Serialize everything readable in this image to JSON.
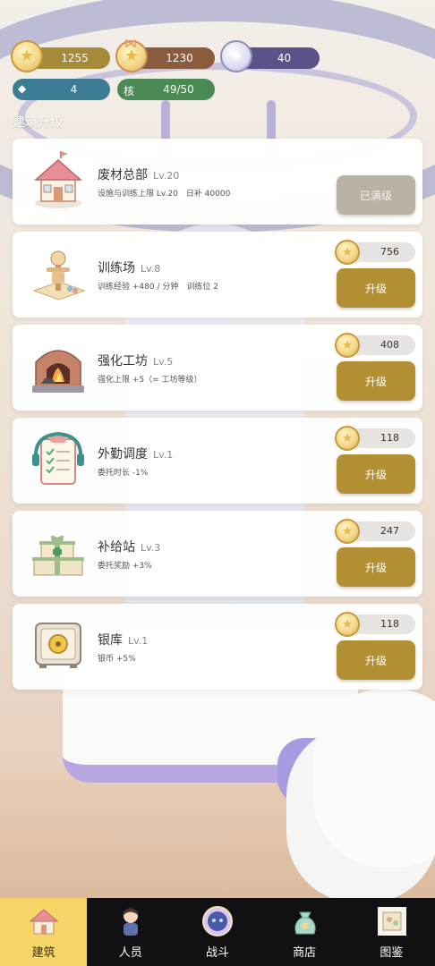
{
  "resources": {
    "coin": {
      "value": "1255",
      "icon": "coin-star-icon"
    },
    "bow_coin": {
      "value": "1230",
      "icon": "bow-coin-icon"
    },
    "gem": {
      "value": "40",
      "icon": "gem-star-icon"
    },
    "diamond": {
      "symbol": "◆",
      "value": "4"
    },
    "core": {
      "label": "核",
      "value": "49/50"
    }
  },
  "section_title": "建筑升级",
  "buildings": [
    {
      "name": "废材总部",
      "level": "Lv.20",
      "desc": "设施与训练上限 Lv.20　日补 40000",
      "button": "已满级",
      "cost": null,
      "icon": "house-icon"
    },
    {
      "name": "训练场",
      "level": "Lv.8",
      "desc": "训练经验 +480 / 分钟　训练位 2",
      "button": "升级",
      "cost": "756",
      "icon": "training-dummy-icon"
    },
    {
      "name": "强化工坊",
      "level": "Lv.5",
      "desc": "强化上限 +5（= 工坊等级）",
      "button": "升级",
      "cost": "408",
      "icon": "furnace-anvil-icon"
    },
    {
      "name": "外勤调度",
      "level": "Lv.1",
      "desc": "委托时长 -1%",
      "button": "升级",
      "cost": "118",
      "icon": "clipboard-headset-icon"
    },
    {
      "name": "补给站",
      "level": "Lv.3",
      "desc": "委托奖励 +3%",
      "button": "升级",
      "cost": "247",
      "icon": "supply-boxes-icon"
    },
    {
      "name": "银库",
      "level": "Lv.1",
      "desc": "银币 +5%",
      "button": "升级",
      "cost": "118",
      "icon": "safe-icon"
    }
  ],
  "nav": [
    {
      "label": "建筑",
      "icon": "house-icon",
      "active": true
    },
    {
      "label": "人员",
      "icon": "character-icon",
      "active": false
    },
    {
      "label": "战斗",
      "icon": "battle-orb-icon",
      "active": false
    },
    {
      "label": "商店",
      "icon": "money-bag-icon",
      "active": false
    },
    {
      "label": "图鉴",
      "icon": "book-icon",
      "active": false
    }
  ],
  "colors": {
    "upgrade_button": "#b28f33",
    "maxed_button": "#b9b3a6",
    "nav_active": "#f6d566",
    "nav_bg": "#111114",
    "coin_bar": "#a58a3a",
    "bow_bar": "#8a5b3c",
    "gem_bar": "#5d5189",
    "diamond_bar": "#3d7c95",
    "core_bar": "#4c8a55"
  }
}
